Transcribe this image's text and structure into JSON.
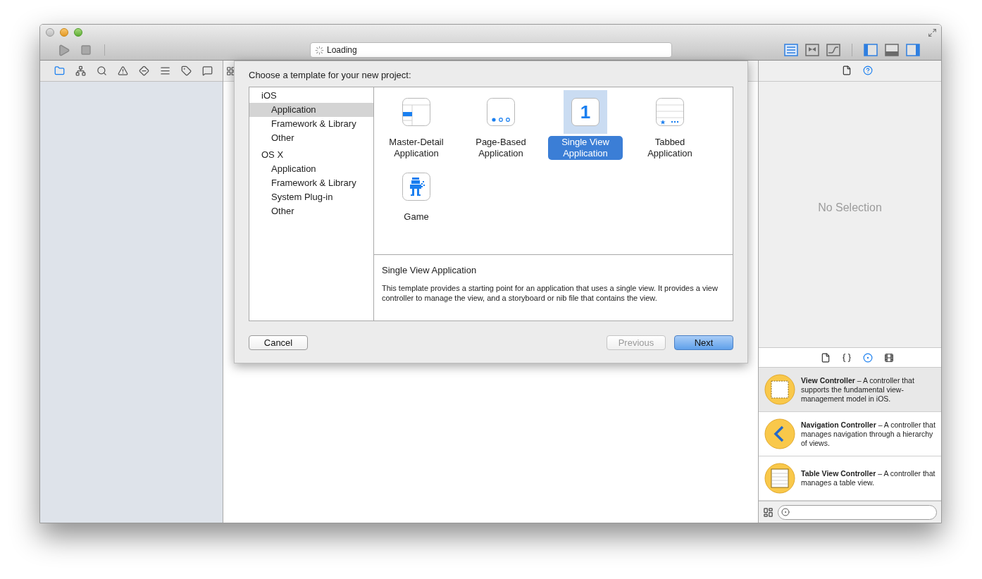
{
  "toolbar": {
    "activity": "Loading",
    "editors": [
      {
        "selected": true
      },
      {
        "selected": false
      },
      {
        "selected": false
      }
    ],
    "views": [
      {
        "on": true
      },
      {
        "on": false
      },
      {
        "on": true
      }
    ]
  },
  "navigator": {
    "tabs": [
      {
        "selected": true
      },
      {
        "selected": false
      },
      {
        "selected": false
      },
      {
        "selected": false
      },
      {
        "selected": false
      },
      {
        "selected": false
      },
      {
        "selected": false
      },
      {
        "selected": false
      }
    ]
  },
  "sheet": {
    "title": "Choose a template for your new project:",
    "categories": [
      {
        "label": "iOS",
        "children": [
          {
            "label": "Application",
            "selected": true
          },
          {
            "label": "Framework & Library",
            "selected": false
          },
          {
            "label": "Other",
            "selected": false
          }
        ]
      },
      {
        "label": "OS X",
        "children": [
          {
            "label": "Application",
            "selected": false
          },
          {
            "label": "Framework & Library",
            "selected": false
          },
          {
            "label": "System Plug-in",
            "selected": false
          },
          {
            "label": "Other",
            "selected": false
          }
        ]
      }
    ],
    "templates": [
      {
        "kind": "master-detail",
        "label": "Master-Detail Application",
        "selected": false
      },
      {
        "kind": "page-based",
        "label": "Page-Based Application",
        "selected": false
      },
      {
        "kind": "single-view",
        "label": "Single View Application",
        "glyph": "1",
        "selected": true
      },
      {
        "kind": "tabbed",
        "label": "Tabbed Application",
        "selected": false
      },
      {
        "kind": "game",
        "label": "Game",
        "selected": false
      }
    ],
    "description": {
      "title": "Single View Application",
      "text": "This template provides a starting point for an application that uses a single view. It provides a view controller to manage the view, and a storyboard or nib file that contains the view."
    },
    "buttons": [
      {
        "label": "Cancel",
        "disabled": false,
        "default": false
      },
      {
        "label": "Previous",
        "disabled": true,
        "default": false
      },
      {
        "label": "Next",
        "disabled": false,
        "default": true
      }
    ]
  },
  "inspector": {
    "tabs": [
      {
        "selected": false
      },
      {
        "selected": true
      }
    ],
    "empty": "No Selection"
  },
  "library": {
    "tabs": [
      {
        "selected": false
      },
      {
        "selected": false
      },
      {
        "selected": true
      },
      {
        "selected": false
      }
    ],
    "items": [
      {
        "kind": "view-controller",
        "text": "**View Controller** – A controller that supports the fundamental view-management model in iOS.",
        "selected": true
      },
      {
        "kind": "navigation-controller",
        "text": "**Navigation Controller** – A controller that manages navigation through a hierarchy of views.",
        "selected": false
      },
      {
        "kind": "table-view-controller",
        "text": "**Table View Controller** – A controller that manages a table view.",
        "selected": false
      }
    ]
  }
}
